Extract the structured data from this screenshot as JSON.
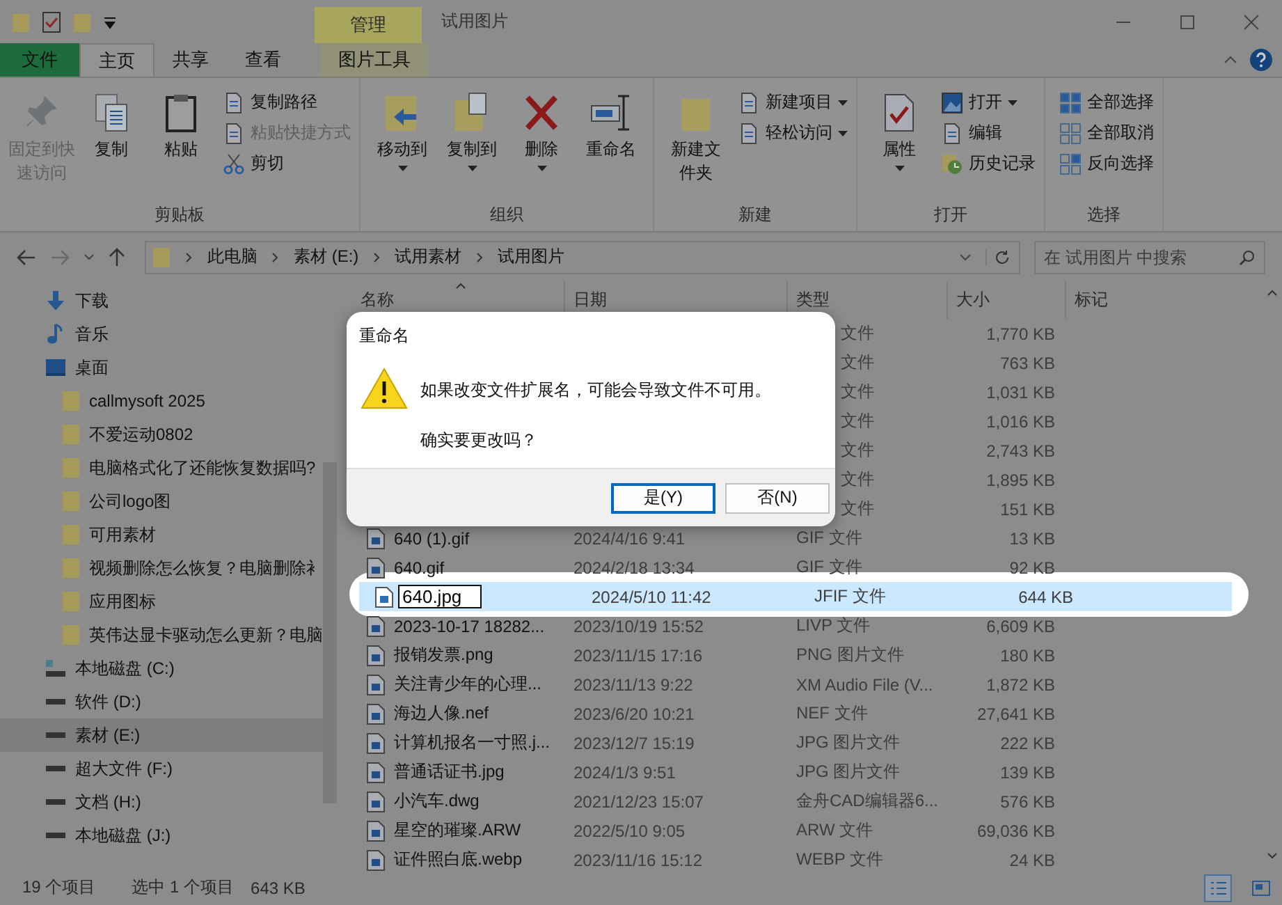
{
  "window": {
    "title": "试用图片",
    "context_tab": "管理"
  },
  "ribbon_tabs": [
    {
      "label": "文件",
      "kind": "file",
      "selected": false
    },
    {
      "label": "主页",
      "kind": "normal",
      "selected": true
    },
    {
      "label": "共享",
      "kind": "normal",
      "selected": false
    },
    {
      "label": "查看",
      "kind": "normal",
      "selected": false
    },
    {
      "label": "图片工具",
      "kind": "context",
      "selected": false
    }
  ],
  "ribbon": {
    "groups": [
      {
        "label": "剪贴板",
        "large": [
          {
            "label": "固定到快速访问",
            "disabled": true,
            "dropdown": false
          },
          {
            "label": "复制",
            "disabled": false,
            "dropdown": false
          },
          {
            "label": "粘贴",
            "disabled": false,
            "dropdown": false
          }
        ],
        "small": [
          {
            "label": "复制路径",
            "disabled": false,
            "dropdown": false
          },
          {
            "label": "粘贴快捷方式",
            "disabled": true,
            "dropdown": false
          },
          {
            "label": "剪切",
            "disabled": false,
            "dropdown": false
          }
        ]
      },
      {
        "label": "组织",
        "large": [
          {
            "label": "移动到",
            "disabled": false,
            "dropdown": true
          },
          {
            "label": "复制到",
            "disabled": false,
            "dropdown": true
          },
          {
            "label": "删除",
            "disabled": false,
            "dropdown": true
          },
          {
            "label": "重命名",
            "disabled": false,
            "dropdown": false
          }
        ]
      },
      {
        "label": "新建",
        "large": [
          {
            "label": "新建文件夹",
            "disabled": false,
            "dropdown": false
          }
        ],
        "small": [
          {
            "label": "新建项目",
            "disabled": false,
            "dropdown": true
          },
          {
            "label": "轻松访问",
            "disabled": false,
            "dropdown": true
          }
        ]
      },
      {
        "label": "打开",
        "large": [
          {
            "label": "属性",
            "disabled": false,
            "dropdown": true
          }
        ],
        "small": [
          {
            "label": "打开",
            "disabled": false,
            "dropdown": true
          },
          {
            "label": "编辑",
            "disabled": false,
            "dropdown": false
          },
          {
            "label": "历史记录",
            "disabled": false,
            "dropdown": false
          }
        ]
      },
      {
        "label": "选择",
        "small": [
          {
            "label": "全部选择",
            "disabled": false,
            "dropdown": false
          },
          {
            "label": "全部取消",
            "disabled": false,
            "dropdown": false
          },
          {
            "label": "反向选择",
            "disabled": false,
            "dropdown": false
          }
        ]
      }
    ]
  },
  "address": {
    "segments": [
      "此电脑",
      "素材 (E:)",
      "试用素材",
      "试用图片"
    ]
  },
  "search": {
    "placeholder": "在 试用图片 中搜索"
  },
  "columns": [
    "名称",
    "日期",
    "类型",
    "大小",
    "标记"
  ],
  "sidebar": [
    {
      "label": "下载",
      "kind": "download",
      "selected": false
    },
    {
      "label": "音乐",
      "kind": "music",
      "selected": false
    },
    {
      "label": "桌面",
      "kind": "desktop",
      "selected": false,
      "children": [
        {
          "label": "callmysoft 2025",
          "kind": "folder",
          "selected": false
        },
        {
          "label": "不爱运动0802",
          "kind": "folder",
          "selected": false
        },
        {
          "label": "电脑格式化了还能恢复数据吗?",
          "kind": "folder",
          "selected": false
        },
        {
          "label": "公司logo图",
          "kind": "folder",
          "selected": false
        },
        {
          "label": "可用素材",
          "kind": "folder",
          "selected": false
        },
        {
          "label": "视频删除怎么恢复？电脑删除衤",
          "kind": "folder",
          "selected": false
        },
        {
          "label": "应用图标",
          "kind": "folder",
          "selected": false
        },
        {
          "label": "英伟达显卡驱动怎么更新？电脑",
          "kind": "folder",
          "selected": false
        }
      ]
    },
    {
      "label": "本地磁盘 (C:)",
      "kind": "system-drive",
      "selected": false
    },
    {
      "label": "软件 (D:)",
      "kind": "drive",
      "selected": false
    },
    {
      "label": "素材 (E:)",
      "kind": "drive",
      "selected": true
    },
    {
      "label": "超大文件 (F:)",
      "kind": "drive",
      "selected": false
    },
    {
      "label": "文档 (H:)",
      "kind": "drive",
      "selected": false
    },
    {
      "label": "本地磁盘 (J:)",
      "kind": "drive",
      "selected": false
    }
  ],
  "rows": [
    {
      "type": "文件",
      "size": "1,770 KB",
      "selected": false
    },
    {
      "type": "文件",
      "size": "763 KB",
      "selected": false
    },
    {
      "type": "文件",
      "size": "1,031 KB",
      "selected": false
    },
    {
      "type": "文件",
      "size": "1,016 KB",
      "selected": false
    },
    {
      "type": "文件",
      "size": "2,743 KB",
      "selected": false
    },
    {
      "type": "文件",
      "size": "1,895 KB",
      "selected": false
    },
    {
      "type": "文件",
      "size": "151 KB",
      "selected": false
    },
    {
      "name": "640 (1).gif",
      "date": "2024/4/16 9:41",
      "type": "GIF 文件",
      "size": "13 KB",
      "selected": false
    },
    {
      "name": "640.gif",
      "date": "2024/2/18 13:34",
      "type": "GIF 文件",
      "size": "92 KB",
      "selected": false
    },
    {
      "name": "640.jpg",
      "date": "2024/5/10 11:42",
      "type": "JFIF 文件",
      "size": "644 KB",
      "selected": true
    },
    {
      "name": "2023-10-17 18282...",
      "date": "2023/10/19 15:52",
      "type": "LIVP 文件",
      "size": "6,609 KB",
      "selected": false
    },
    {
      "name": "报销发票.png",
      "date": "2023/11/15 17:16",
      "type": "PNG 图片文件",
      "size": "180 KB",
      "selected": false
    },
    {
      "name": "关注青少年的心理...",
      "date": "2023/11/13 9:22",
      "type": "XM Audio File (V...",
      "size": "1,872 KB",
      "selected": false
    },
    {
      "name": "海边人像.nef",
      "date": "2023/6/20 10:21",
      "type": "NEF 文件",
      "size": "27,641 KB",
      "selected": false
    },
    {
      "name": "计算机报名一寸照.j...",
      "date": "2023/12/7 15:19",
      "type": "JPG 图片文件",
      "size": "222 KB",
      "selected": false
    },
    {
      "name": "普通话证书.jpg",
      "date": "2024/1/3 9:51",
      "type": "JPG 图片文件",
      "size": "139 KB",
      "selected": false
    },
    {
      "name": "小汽车.dwg",
      "date": "2021/12/23 15:07",
      "type": "金舟CAD编辑器6...",
      "size": "576 KB",
      "selected": false
    },
    {
      "name": "星空的璀璨.ARW",
      "date": "2022/5/10 9:05",
      "type": "ARW 文件",
      "size": "69,036 KB",
      "selected": false
    },
    {
      "name": "证件照白底.webp",
      "date": "2023/11/16 15:12",
      "type": "WEBP 文件",
      "size": "24 KB",
      "selected": false
    }
  ],
  "status_bar": {
    "count": "19 个项目",
    "selection": "选中 1 个项目",
    "size": "643 KB"
  },
  "dialog": {
    "title": "重命名",
    "message": "如果改变文件扩展名，可能会导致文件不可用。",
    "question": "确实要更改吗？",
    "buttons": [
      {
        "label": "是(Y)",
        "default": true
      },
      {
        "label": "否(N)",
        "default": false
      }
    ]
  }
}
